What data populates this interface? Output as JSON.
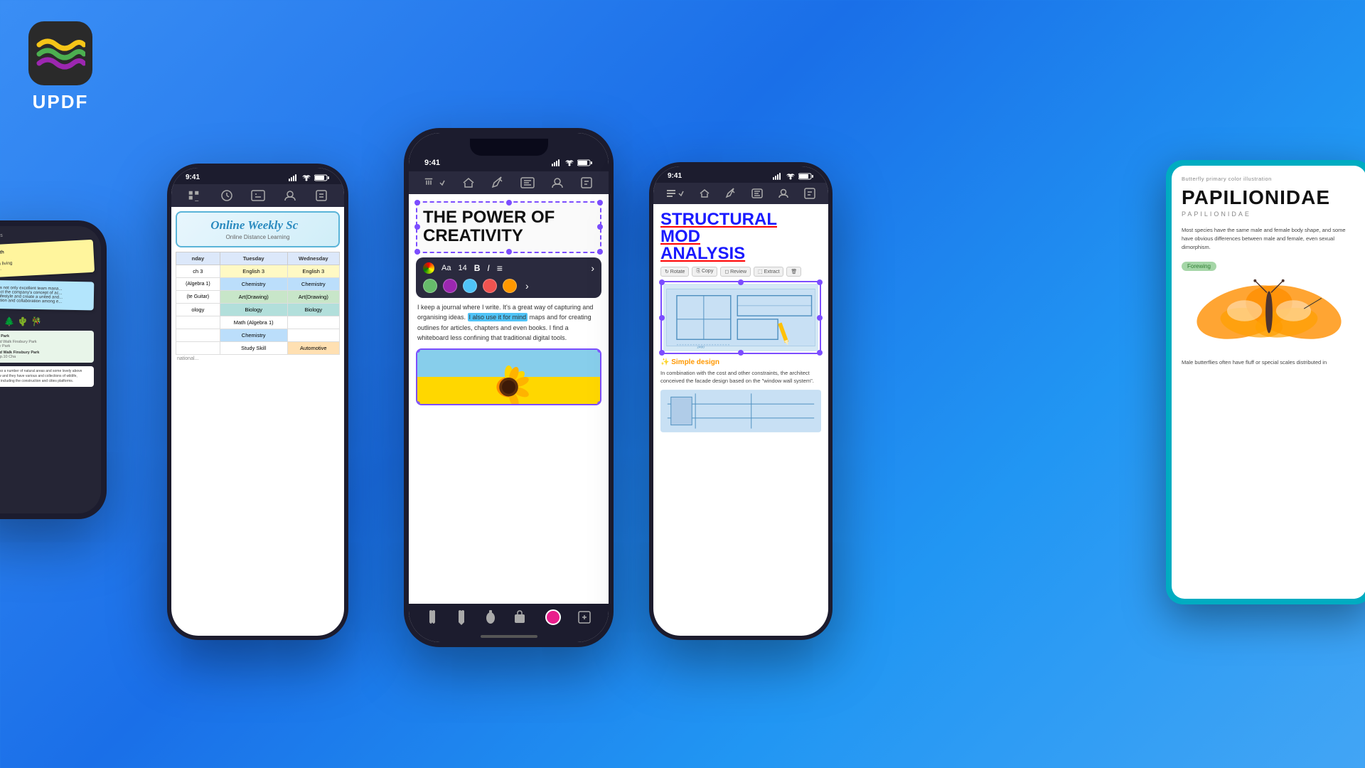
{
  "app": {
    "name": "UPDF",
    "logo_alt": "UPDF app logo"
  },
  "background": {
    "color": "#2b7de9"
  },
  "hero_text": {
    "line1": "THE POWER OF",
    "line2": "CREATIVITY"
  },
  "phones": {
    "center": {
      "status_time": "9:41",
      "doc_title": "THE POWER OF CREATIVITY",
      "doc_body_text": "I keep a journal where I write. It's a great way of capturing and organising ideas.",
      "highlight_text": "I also use it for mind",
      "doc_body_text2": "maps and for creating outlines for articles, chapters and even books. I find a whiteboard less confining that traditional digital tools.",
      "format_size": "14"
    },
    "schedule": {
      "status_time": "9:41",
      "title": "Online Weekly Sc",
      "subtitle": "Online Distance Learning",
      "days": [
        "nday",
        "Tuesday",
        "Wednesday"
      ],
      "rows": [
        [
          "ch 3",
          "English 3",
          "English 3"
        ],
        [
          "Algebra 1)",
          "Chemistry",
          "Chemistry"
        ],
        [
          "te Guitar)",
          "Art(Drawing)",
          "Art(Drawing)"
        ],
        [
          "ology",
          "Biology",
          "Biology"
        ],
        [
          "",
          "Math (Algebra 1)",
          ""
        ],
        [
          "",
          "Chemistry",
          ""
        ],
        [
          "",
          "Study Skill",
          "Automotive"
        ]
      ]
    },
    "structural": {
      "status_time": "9:41",
      "title": "STRUCTURAL MOD",
      "title2": "ANALYSIS",
      "design_label": "✨ Simple design",
      "desc": "In combination with the cost and other constraints, the architect conceived the facade design based on the \"window wall system\"."
    }
  },
  "tablet_right": {
    "category": "Butterfly primary color illustration",
    "main_title": "PAPILIONIDAE",
    "subtitle": "PAPILIONIDAE",
    "desc1": "Most species have the same male and female body shape, and some have obvious differences between male and female, even sexual dimorphism.",
    "annotation": "Forewing",
    "desc2": "Male butterflies often have fluff or special scales distributed in"
  },
  "schedule_cells": {
    "yellow_cells": [
      "English 3",
      "English 3"
    ],
    "blue_cells": [
      "Chemistry",
      "Chemistry"
    ],
    "green_cells": [
      "Art(Drawing)",
      "Art(Drawing)"
    ],
    "teal_cells": [
      "Biology",
      "Biology"
    ],
    "highlight_chemistry": "Chemistry"
  }
}
